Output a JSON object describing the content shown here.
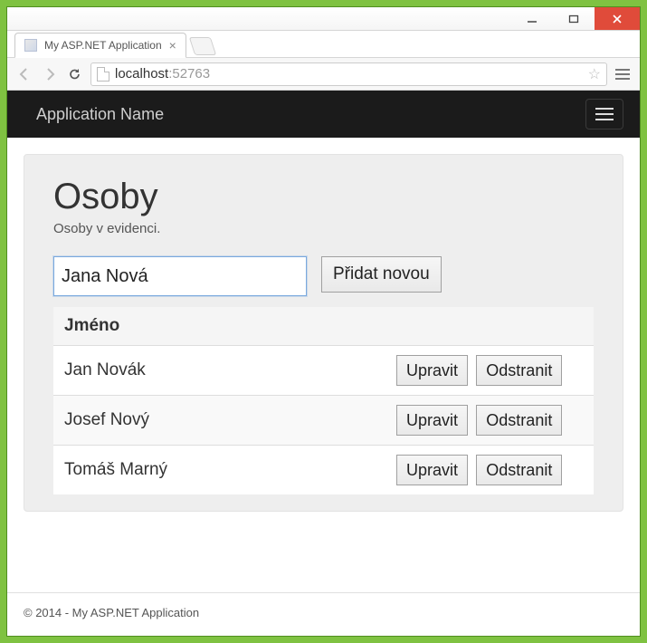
{
  "window": {
    "tab_title": "My ASP.NET Application",
    "url_host": "localhost",
    "url_port": ":52763"
  },
  "navbar": {
    "brand": "Application Name"
  },
  "page": {
    "heading": "Osoby",
    "subtitle": "Osoby v evidenci.",
    "input_value": "Jana Nová",
    "add_button_label": "Přidat novou",
    "column_header": "Jméno",
    "edit_label": "Upravit",
    "delete_label": "Odstranit",
    "rows": [
      {
        "name": "Jan Novák"
      },
      {
        "name": "Josef Nový"
      },
      {
        "name": "Tomáš Marný"
      }
    ]
  },
  "footer": {
    "text": "© 2014 - My ASP.NET Application"
  }
}
